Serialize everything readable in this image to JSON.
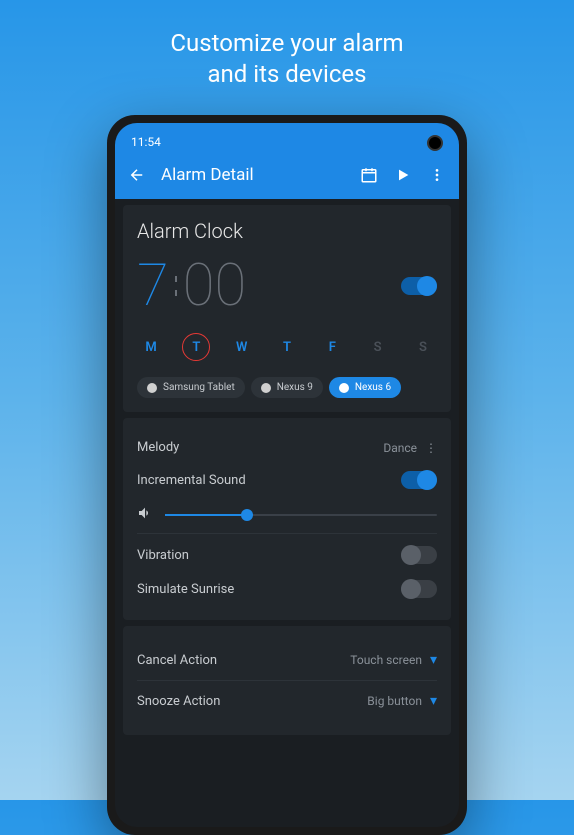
{
  "promo": {
    "line1": "Customize your alarm",
    "line2": "and its devices"
  },
  "statusBar": {
    "time": "11:54"
  },
  "appBar": {
    "title": "Alarm Detail"
  },
  "alarm": {
    "title": "Alarm Clock",
    "hour": "7",
    "minutes": "00",
    "enabled": true,
    "days": [
      {
        "label": "M",
        "active": true,
        "selected": false
      },
      {
        "label": "T",
        "active": true,
        "selected": true
      },
      {
        "label": "W",
        "active": true,
        "selected": false
      },
      {
        "label": "T",
        "active": true,
        "selected": false
      },
      {
        "label": "F",
        "active": true,
        "selected": false
      },
      {
        "label": "S",
        "active": false,
        "selected": false
      },
      {
        "label": "S",
        "active": false,
        "selected": false
      }
    ],
    "devices": [
      {
        "name": "Samsung Tablet",
        "active": false
      },
      {
        "name": "Nexus 9",
        "active": false
      },
      {
        "name": "Nexus 6",
        "active": true
      }
    ]
  },
  "sound": {
    "melodyLabel": "Melody",
    "melodyValue": "Dance",
    "incrementalLabel": "Incremental Sound",
    "incrementalEnabled": true,
    "volumePercent": 30,
    "vibrationLabel": "Vibration",
    "vibrationEnabled": false,
    "sunriseLabel": "Simulate Sunrise",
    "sunriseEnabled": false
  },
  "actions": {
    "cancelLabel": "Cancel Action",
    "cancelValue": "Touch screen",
    "snoozeLabel": "Snooze Action",
    "snoozeValue": "Big button"
  }
}
